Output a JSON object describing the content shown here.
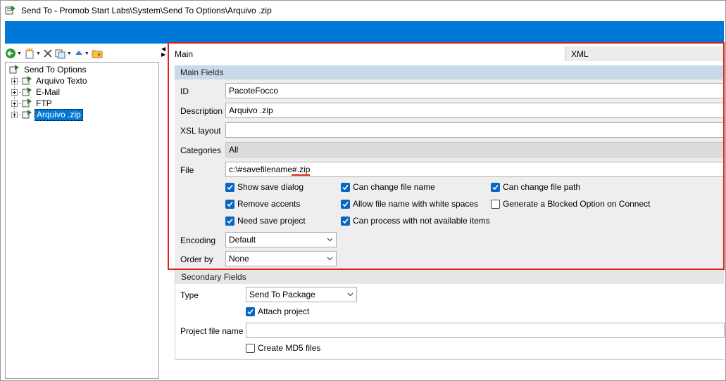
{
  "window": {
    "title": "Send To - Promob Start Labs\\System\\Send To Options\\Arquivo .zip"
  },
  "tree": {
    "root": "Send To Options",
    "items": [
      {
        "label": "Arquivo Texto",
        "selected": false
      },
      {
        "label": "E-Mail",
        "selected": false
      },
      {
        "label": "FTP",
        "selected": false
      },
      {
        "label": "Arquivo .zip",
        "selected": true
      }
    ]
  },
  "tabs": {
    "main": "Main",
    "xml": "XML"
  },
  "main_fields": {
    "header": "Main Fields",
    "id_label": "ID",
    "id_value": "PacoteFocco",
    "description_label": "Description",
    "description_value": "Arquivo .zip",
    "xsl_label": "XSL layout",
    "xsl_value": "",
    "categories_label": "Categories",
    "categories_value": "All",
    "file_label": "File",
    "file_value": "c:\\#savefilename#.zip",
    "checkboxes": [
      {
        "label": "Show save dialog",
        "checked": true
      },
      {
        "label": "Can change file name",
        "checked": true
      },
      {
        "label": "Can change file path",
        "checked": true
      },
      {
        "label": "Remove accents",
        "checked": true
      },
      {
        "label": "Allow file name with white spaces",
        "checked": true
      },
      {
        "label": "Generate a Blocked Option on Connect",
        "checked": false
      },
      {
        "label": "Need save project",
        "checked": true
      },
      {
        "label": "Can process with not available items",
        "checked": true
      }
    ],
    "encoding_label": "Encoding",
    "encoding_value": "Default",
    "order_label": "Order by",
    "order_value": "None"
  },
  "secondary_fields": {
    "header": "Secondary Fields",
    "type_label": "Type",
    "type_value": "Send To Package",
    "attach_project": {
      "label": "Attach project",
      "checked": true
    },
    "project_file_label": "Project file name",
    "project_file_value": "",
    "create_md5": {
      "label": "Create MD5 files",
      "checked": false
    }
  },
  "colors": {
    "accent": "#0078d7",
    "highlight": "#e0201a",
    "group_header": "#c9d9ea"
  }
}
